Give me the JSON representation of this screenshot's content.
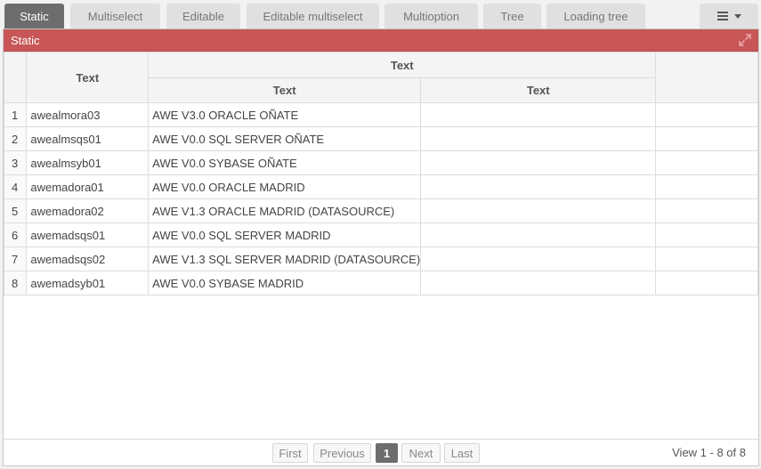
{
  "tabs": [
    {
      "label": "Static",
      "active": true
    },
    {
      "label": "Multiselect",
      "active": false
    },
    {
      "label": "Editable",
      "active": false
    },
    {
      "label": "Editable multiselect",
      "active": false
    },
    {
      "label": "Multioption",
      "active": false
    },
    {
      "label": "Tree",
      "active": false
    },
    {
      "label": "Loading tree",
      "active": false
    }
  ],
  "menu": {
    "icon": "hamburger-icon",
    "caret": "caret-down-icon"
  },
  "panel": {
    "title": "Static",
    "expand_icon": "expand-icon",
    "header_color": "#c85656"
  },
  "grid": {
    "columns": {
      "col1": "Text",
      "group": "Text",
      "col2": "Text",
      "col3": "Text"
    },
    "rows": [
      {
        "num": "1",
        "c1": "awealmora03",
        "c2": "AWE V3.0 ORACLE OÑATE",
        "c3": ""
      },
      {
        "num": "2",
        "c1": "awealmsqs01",
        "c2": "AWE V0.0 SQL SERVER OÑATE",
        "c3": ""
      },
      {
        "num": "3",
        "c1": "awealmsyb01",
        "c2": "AWE V0.0 SYBASE OÑATE",
        "c3": ""
      },
      {
        "num": "4",
        "c1": "awemadora01",
        "c2": "AWE V0.0 ORACLE MADRID",
        "c3": ""
      },
      {
        "num": "5",
        "c1": "awemadora02",
        "c2": "AWE V1.3 ORACLE MADRID (DATASOURCE)",
        "c3": ""
      },
      {
        "num": "6",
        "c1": "awemadsqs01",
        "c2": "AWE V0.0 SQL SERVER MADRID",
        "c3": ""
      },
      {
        "num": "7",
        "c1": "awemadsqs02",
        "c2": "AWE V1.3 SQL SERVER MADRID (DATASOURCE)",
        "c3": ""
      },
      {
        "num": "8",
        "c1": "awemadsyb01",
        "c2": "AWE V0.0 SYBASE MADRID",
        "c3": ""
      }
    ]
  },
  "pager": {
    "first": "First",
    "previous": "Previous",
    "current_page": "1",
    "next": "Next",
    "last": "Last",
    "view_info": "View 1 - 8 of 8"
  }
}
